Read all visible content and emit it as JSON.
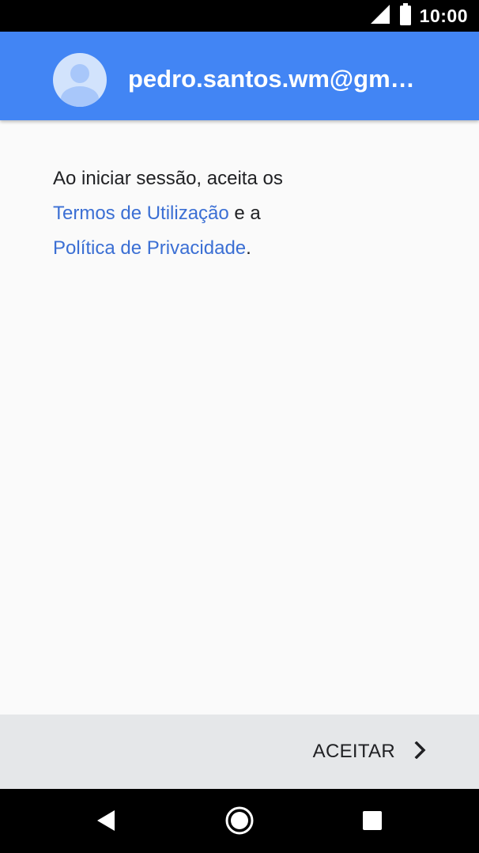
{
  "status_bar": {
    "time": "10:00",
    "icons": [
      "signal-icon",
      "battery-icon"
    ]
  },
  "header": {
    "email": "pedro.santos.wm@gm…",
    "avatar_icon": "person-icon",
    "background_color": "#4285f4"
  },
  "content": {
    "line1": "Ao iniciar sessão, aceita os",
    "terms_link": "Termos de Utilização",
    "connector": " e a",
    "privacy_link": "Política de Privacidade",
    "period": ".",
    "link_color": "#3b6fd4"
  },
  "footer": {
    "accept_label": "ACEITAR",
    "accept_icon": "chevron-right-icon"
  },
  "nav_bar": {
    "icons": [
      "back-icon",
      "home-icon",
      "recents-icon"
    ]
  }
}
